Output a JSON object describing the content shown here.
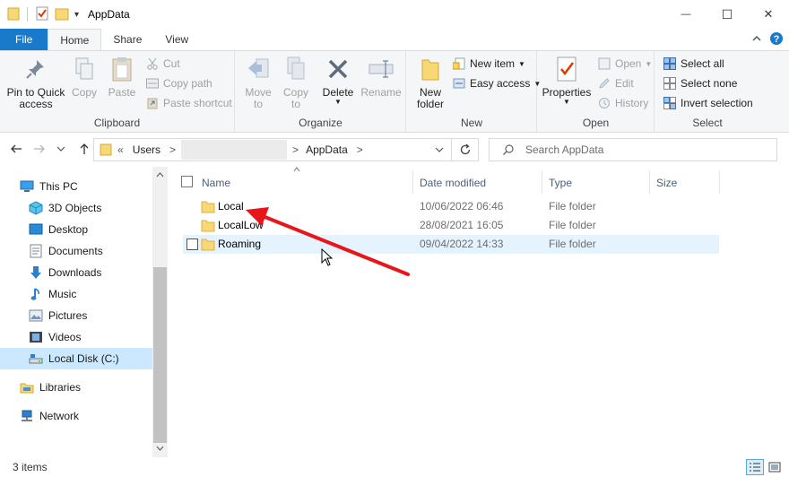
{
  "window": {
    "title": "AppData",
    "qa_dropdown": "▾",
    "minimize_glyph": "—",
    "maximize_glyph": "☐",
    "close_glyph": "✕"
  },
  "tabs": [
    {
      "label": "File"
    },
    {
      "label": "Home"
    },
    {
      "label": "Share"
    },
    {
      "label": "View"
    }
  ],
  "ribbon": {
    "clipboard": {
      "label": "Clipboard",
      "pin_to_quick_access": "Pin to Quick\naccess",
      "copy": "Copy",
      "paste": "Paste",
      "cut": "Cut",
      "copy_path": "Copy path",
      "paste_shortcut": "Paste shortcut"
    },
    "organize": {
      "label": "Organize",
      "move_to": "Move\nto",
      "copy_to": "Copy\nto",
      "delete": "Delete",
      "rename": "Rename"
    },
    "new": {
      "label": "New",
      "new_folder": "New\nfolder",
      "new_item": "New item",
      "easy_access": "Easy access"
    },
    "open": {
      "label": "Open",
      "properties": "Properties",
      "open": "Open",
      "edit": "Edit",
      "history": "History"
    },
    "select": {
      "label": "Select",
      "select_all": "Select all",
      "select_none": "Select none",
      "invert_selection": "Invert selection"
    }
  },
  "address": {
    "overflow": "«",
    "segments": [
      "Users",
      "AppData"
    ],
    "separator": ">"
  },
  "search": {
    "placeholder": "Search AppData"
  },
  "navigation": {
    "items": [
      {
        "label": "This PC",
        "icon": "pc-icon"
      },
      {
        "label": "3D Objects",
        "icon": "3d-objects-icon"
      },
      {
        "label": "Desktop",
        "icon": "desktop-icon"
      },
      {
        "label": "Documents",
        "icon": "documents-icon"
      },
      {
        "label": "Downloads",
        "icon": "downloads-icon"
      },
      {
        "label": "Music",
        "icon": "music-icon"
      },
      {
        "label": "Pictures",
        "icon": "pictures-icon"
      },
      {
        "label": "Videos",
        "icon": "videos-icon"
      },
      {
        "label": "Local Disk (C:)",
        "icon": "drive-icon"
      },
      {
        "label": "Libraries",
        "icon": "libraries-icon"
      },
      {
        "label": "Network",
        "icon": "network-icon"
      }
    ]
  },
  "file_list": {
    "columns": [
      "Name",
      "Date modified",
      "Type",
      "Size"
    ],
    "rows": [
      {
        "name": "Local",
        "date": "10/06/2022 06:46",
        "type": "File folder"
      },
      {
        "name": "LocalLow",
        "date": "28/08/2021 16:05",
        "type": "File folder"
      },
      {
        "name": "Roaming",
        "date": "09/04/2022 14:33",
        "type": "File folder"
      }
    ]
  },
  "status": {
    "item_count": "3 items"
  },
  "colors": {
    "file_tab": "#1979ca",
    "folder": "#f8d775",
    "selection": "#cce8ff",
    "hover": "#e5f3ff",
    "annotation_arrow": "#e8151b"
  }
}
